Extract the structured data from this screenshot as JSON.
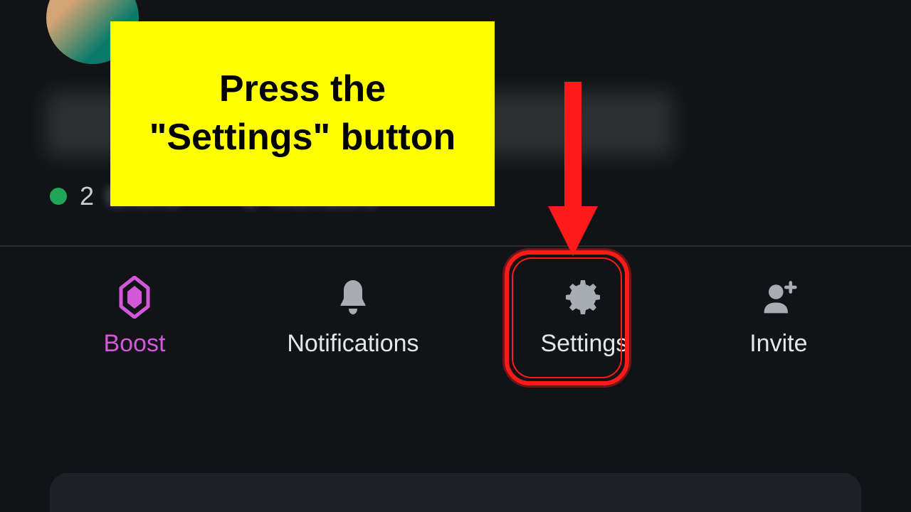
{
  "callout": {
    "line1": "Press the",
    "line2": "\"Settings\" button"
  },
  "status": {
    "online_count": "2",
    "online_label": "Online",
    "members_count": "2",
    "members_label": "Members"
  },
  "actions": {
    "boost": "Boost",
    "notifications": "Notifications",
    "settings": "Settings",
    "invite": "Invite"
  },
  "colors": {
    "callout_bg": "#ffff00",
    "arrow": "#ff1a1a",
    "highlight": "#ff1a1a",
    "boost_accent": "#d358d9",
    "online": "#22a559"
  }
}
